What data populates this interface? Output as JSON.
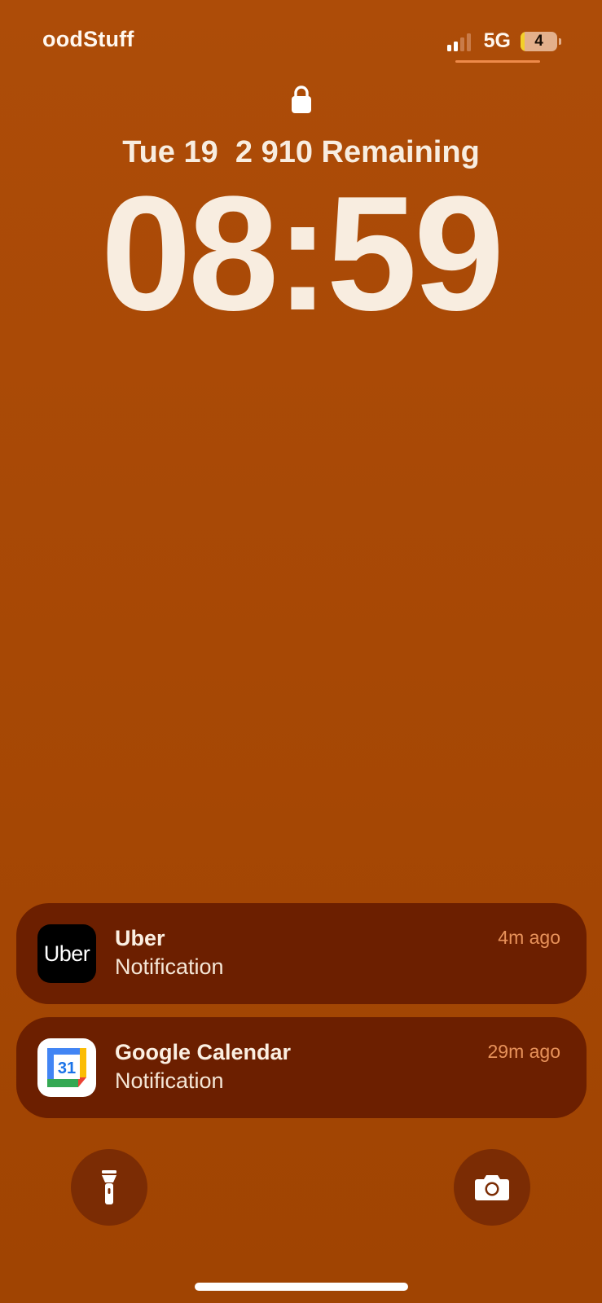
{
  "status_bar": {
    "carrier": "oodStuff",
    "network": "5G",
    "battery_level": "4",
    "signal_bars_active": 2,
    "signal_bars_total": 4
  },
  "lock_screen": {
    "date_line": "Tue 19  2 910 Remaining",
    "time": "08:59"
  },
  "notifications": [
    {
      "app": "Uber",
      "icon": "uber-app-icon",
      "icon_text": "Uber",
      "body": "Notification",
      "time": "4m ago"
    },
    {
      "app": "Google Calendar",
      "icon": "google-calendar-app-icon",
      "icon_text": "31",
      "body": "Notification",
      "time": "29m ago"
    }
  ],
  "quick_actions": {
    "left": "flashlight-icon",
    "right": "camera-icon"
  },
  "colors": {
    "background": "#a74805",
    "notification_bg": "#6c1f00",
    "time_accent": "#e8925a",
    "quick_action_bg": "#7b2c04"
  }
}
